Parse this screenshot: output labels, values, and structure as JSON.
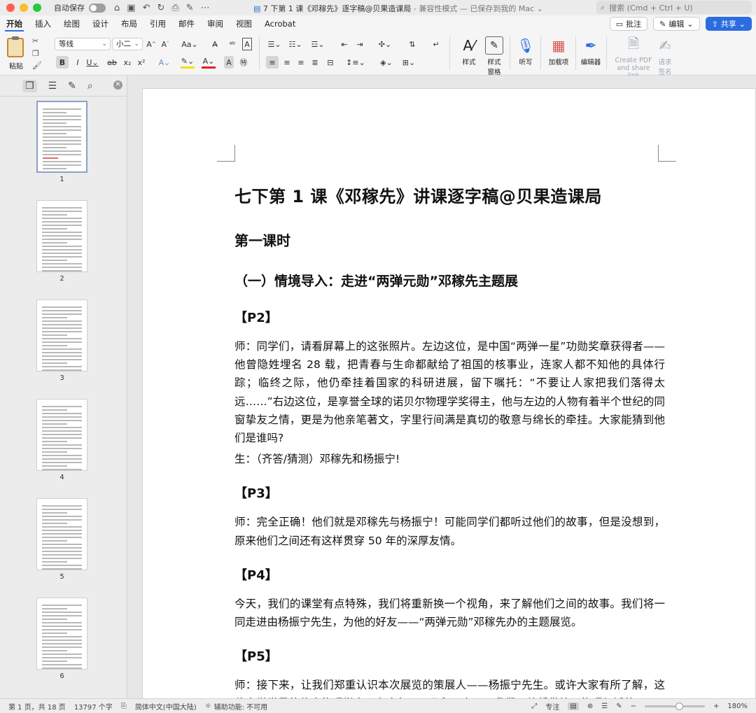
{
  "titlebar": {
    "autosave_label": "自动保存",
    "doc_title": "7 下第 1 课《邓稼先》逐字稿@贝果造课局",
    "doc_mode": " -  兼容性模式 — 已保存到我的 Mac",
    "search_placeholder": "搜索 (Cmd + Ctrl + U)"
  },
  "ribbon_tabs": [
    "开始",
    "插入",
    "绘图",
    "设计",
    "布局",
    "引用",
    "邮件",
    "审阅",
    "视图",
    "Acrobat"
  ],
  "ribbon_tab_active": "开始",
  "ribbon_right": {
    "comments": "批注",
    "edit": "编辑",
    "share": "共享"
  },
  "ribbon": {
    "paste": "粘贴",
    "font_name": "等线",
    "font_size": "小二",
    "styles": "样式",
    "styles_pane_1": "样式",
    "styles_pane_2": "窗格",
    "dictate": "听写",
    "addins": "加载项",
    "editor": "编辑器",
    "create_pdf_1": "Create PDF",
    "create_pdf_2": "and share link",
    "request_sign_1": "请求",
    "request_sign_2": "签名"
  },
  "sidebar": {
    "pages": [
      "1",
      "2",
      "3",
      "4",
      "5",
      "6"
    ]
  },
  "document": {
    "title": "七下第 1 课《邓稼先》讲课逐字稿@贝果造课局",
    "section": "第一课时",
    "subsection": "（一）情境导入：走进“两弹元勋”邓稼先主题展",
    "p2_label": "【P2】",
    "p2_teacher": "师：同学们，请看屏幕上的这张照片。左边这位，是中国“两弹一星”功勋奖章获得者——他曾隐姓埋名 28 载，把青春与生命都献给了祖国的核事业，连家人都不知他的具体行踪；临终之际，他仍牵挂着国家的科研进展，留下嘱托：“不要让人家把我们落得太远……”右边这位，是享誉全球的诺贝尔物理学奖得主，他与左边的人物有着半个世纪的同窗挚友之情，更是为他亲笔著文，字里行间满是真切的敬意与绵长的牵挂。大家能猜到他们是谁吗?",
    "p2_student": "生：（齐答/猜测）邓稼先和杨振宁!",
    "p3_label": "【P3】",
    "p3_teacher": "师：完全正确！他们就是邓稼先与杨振宁！可能同学们都听过他们的故事，但是没想到，原来他们之间还有这样贯穿 50 年的深厚友情。",
    "p4_label": "【P4】",
    "p4_text": "今天，我们的课堂有点特殊，我们将重新换一个视角，来了解他们之间的故事。我们将一同走进由杨振宁先生，为他的好友——“两弹元勋”邓稼先办的主题展览。",
    "p5_label": "【P5】",
    "p5_teacher": "师：接下来，让我们郑重认识本次展览的策展人——杨振宁先生。或许大家有所了解，这位享誉世界的伟大物理学家，在去年 10 月永远离开了我们。他凭借粒子物理领域的"
  },
  "status": {
    "page_info": "第 1 页，共 18 页",
    "word_count": "13797 个字",
    "language": "简体中文(中国大陆)",
    "accessibility": "辅助功能: 不可用",
    "focus": "专注",
    "zoom": "180%"
  },
  "colors": {
    "accent": "#2b6de0",
    "close": "#ff5f57",
    "minimize": "#febc2e",
    "maximize": "#28c840"
  }
}
